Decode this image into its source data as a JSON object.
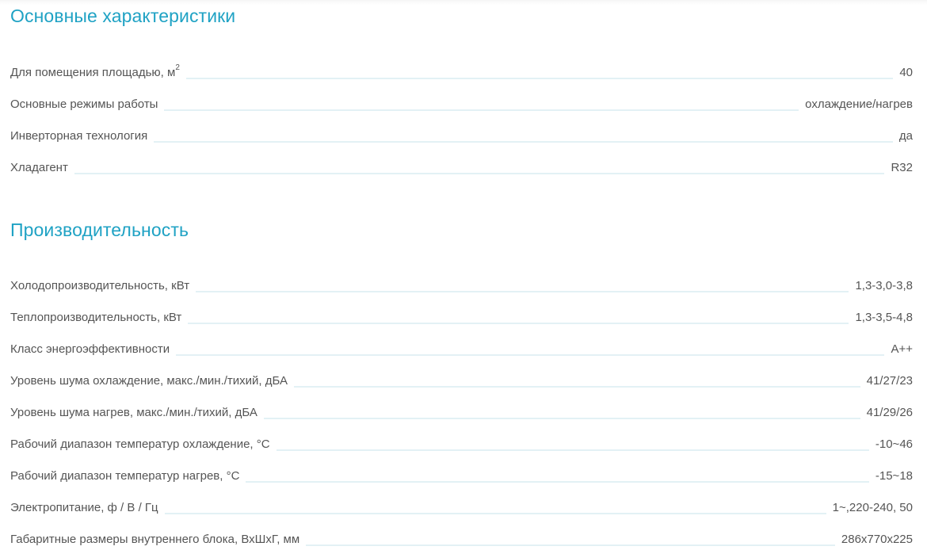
{
  "sections": [
    {
      "title": "Основные характеристики",
      "rows": [
        {
          "label": "Для помещения площадью, м",
          "sup": "2",
          "value": "40"
        },
        {
          "label": "Основные режимы работы",
          "value": "охлаждение/нагрев"
        },
        {
          "label": "Инверторная технология",
          "value": "да"
        },
        {
          "label": "Хладагент",
          "value": "R32"
        }
      ]
    },
    {
      "title": "Производительность",
      "rows": [
        {
          "label": "Холодопроизводительность, кВт",
          "value": "1,3-3,0-3,8"
        },
        {
          "label": "Теплопроизводительность, кВт",
          "value": "1,3-3,5-4,8"
        },
        {
          "label": "Класс энергоэффективности",
          "value": "A++"
        },
        {
          "label": "Уровень шума охлаждение, макс./мин./тихий, дБА",
          "value": "41/27/23"
        },
        {
          "label": "Уровень шума нагрев, макс./мин./тихий, дБА",
          "value": "41/29/26"
        },
        {
          "label": "Рабочий диапазон температур охлаждение, °С",
          "value": "-10~46"
        },
        {
          "label": "Рабочий диапазон температур нагрев, °С",
          "value": "-15~18"
        },
        {
          "label": "Электропитание, ф / В / Гц",
          "value": "1~,220-240, 50"
        },
        {
          "label": "Габаритные размеры внутреннего блока, ВхШхГ, мм",
          "value": "286х770х225"
        }
      ]
    }
  ],
  "colors": {
    "heading": "#1fa2c4",
    "text": "#555555",
    "leader": "#e3f1f5"
  }
}
